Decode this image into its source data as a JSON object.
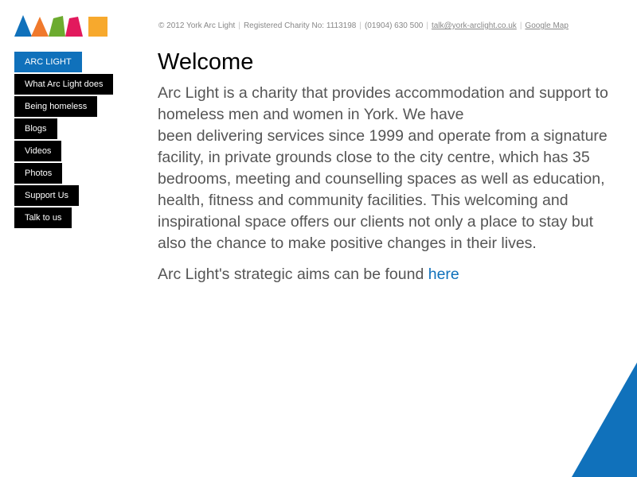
{
  "brand": {
    "logo_colors": [
      "#1071bb",
      "#f0792c",
      "#6cab2f",
      "#e2195d",
      "#f7a92d"
    ],
    "corner_color": "#1071bb"
  },
  "header": {
    "copyright": "© 2012 York Arc Light",
    "charity": "Registered Charity No: 1113198",
    "phone": "(01904) 630 500",
    "email": "talk@york-arclight.co.uk",
    "map_link": "Google Map"
  },
  "nav": {
    "items": [
      {
        "label": "ARC LIGHT",
        "active": true
      },
      {
        "label": "What Arc Light does",
        "active": false
      },
      {
        "label": "Being homeless",
        "active": false
      },
      {
        "label": "Blogs",
        "active": false
      },
      {
        "label": "Videos",
        "active": false
      },
      {
        "label": "Photos",
        "active": false
      },
      {
        "label": "Support Us",
        "active": false
      },
      {
        "label": "Talk to us",
        "active": false
      }
    ]
  },
  "content": {
    "title": "Welcome",
    "intro_line1": "Arc Light is a charity that provides accommodation and support to homeless men and women in York. We have",
    "intro_line2": "been delivering services since 1999 and operate from a signature facility, in private grounds close to the city centre, which has 35 bedrooms, meeting and counselling spaces as well as education, health, fitness and community facilities. This welcoming and inspirational space offers our clients not only a place to stay but also the chance to make positive changes in their lives.",
    "aims_text": "Arc Light's strategic aims can be found ",
    "aims_link": "here"
  }
}
